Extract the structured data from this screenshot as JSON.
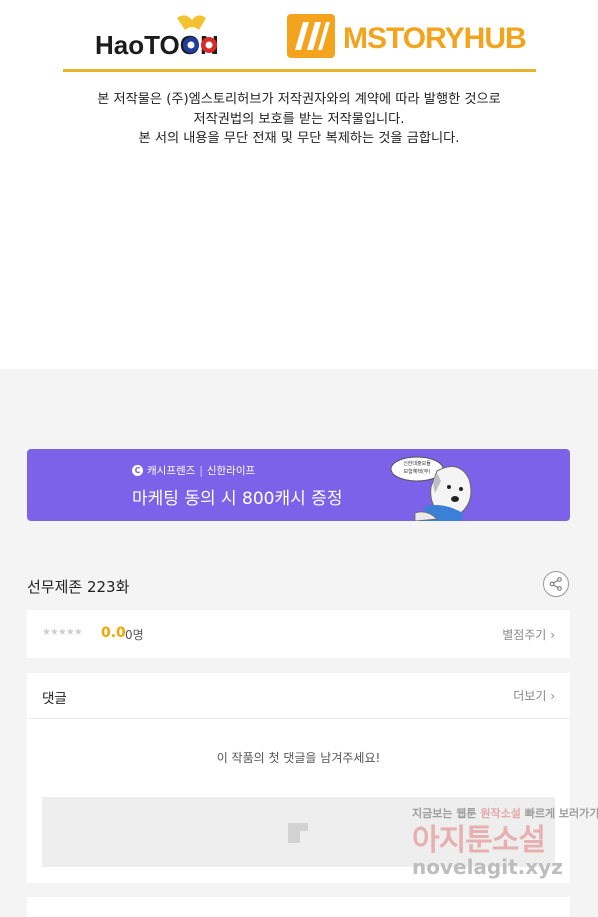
{
  "banner": {
    "haotoon_logo_text": "HaoTOON",
    "mstory_logo_text": "MSTORYHUB",
    "brand_gold": "#e7b32a",
    "notice_lines": [
      "본 저작물은 (주)엠스토리허브가 저작권자와의 계약에 따라 발행한 것으로",
      "저작권법의 보호를 받는 저작물입니다.",
      "본 서의 내용을 무단 전재 및 무단 복제하는 것을 금합니다."
    ]
  },
  "ad": {
    "brand_left": "캐시프렌즈",
    "brand_right": "신한라이프",
    "title": "마케팅 동의 시 800캐시 증정",
    "bubble_text": "신한대출모듈 보험혜택(무)",
    "background": "#7a63e8"
  },
  "episode": {
    "title": "선무제존 223화",
    "share_icon": "share-icon"
  },
  "rating": {
    "stars": "★★★★★",
    "score": "0.0",
    "count": "0명",
    "rate_link": "별점주기",
    "score_color": "#f0a500"
  },
  "comments": {
    "header": "댓글",
    "more_link": "더보기",
    "empty_text": "이 작품의 첫 댓글을 남겨주세요!"
  },
  "watermark": {
    "line1_a": "지금보는 웹툰",
    "line1_b": "빠르게 보러가기",
    "line1_hl": "원작소설",
    "line2": "아지툰소설",
    "line3": "novelagit.xyz"
  }
}
